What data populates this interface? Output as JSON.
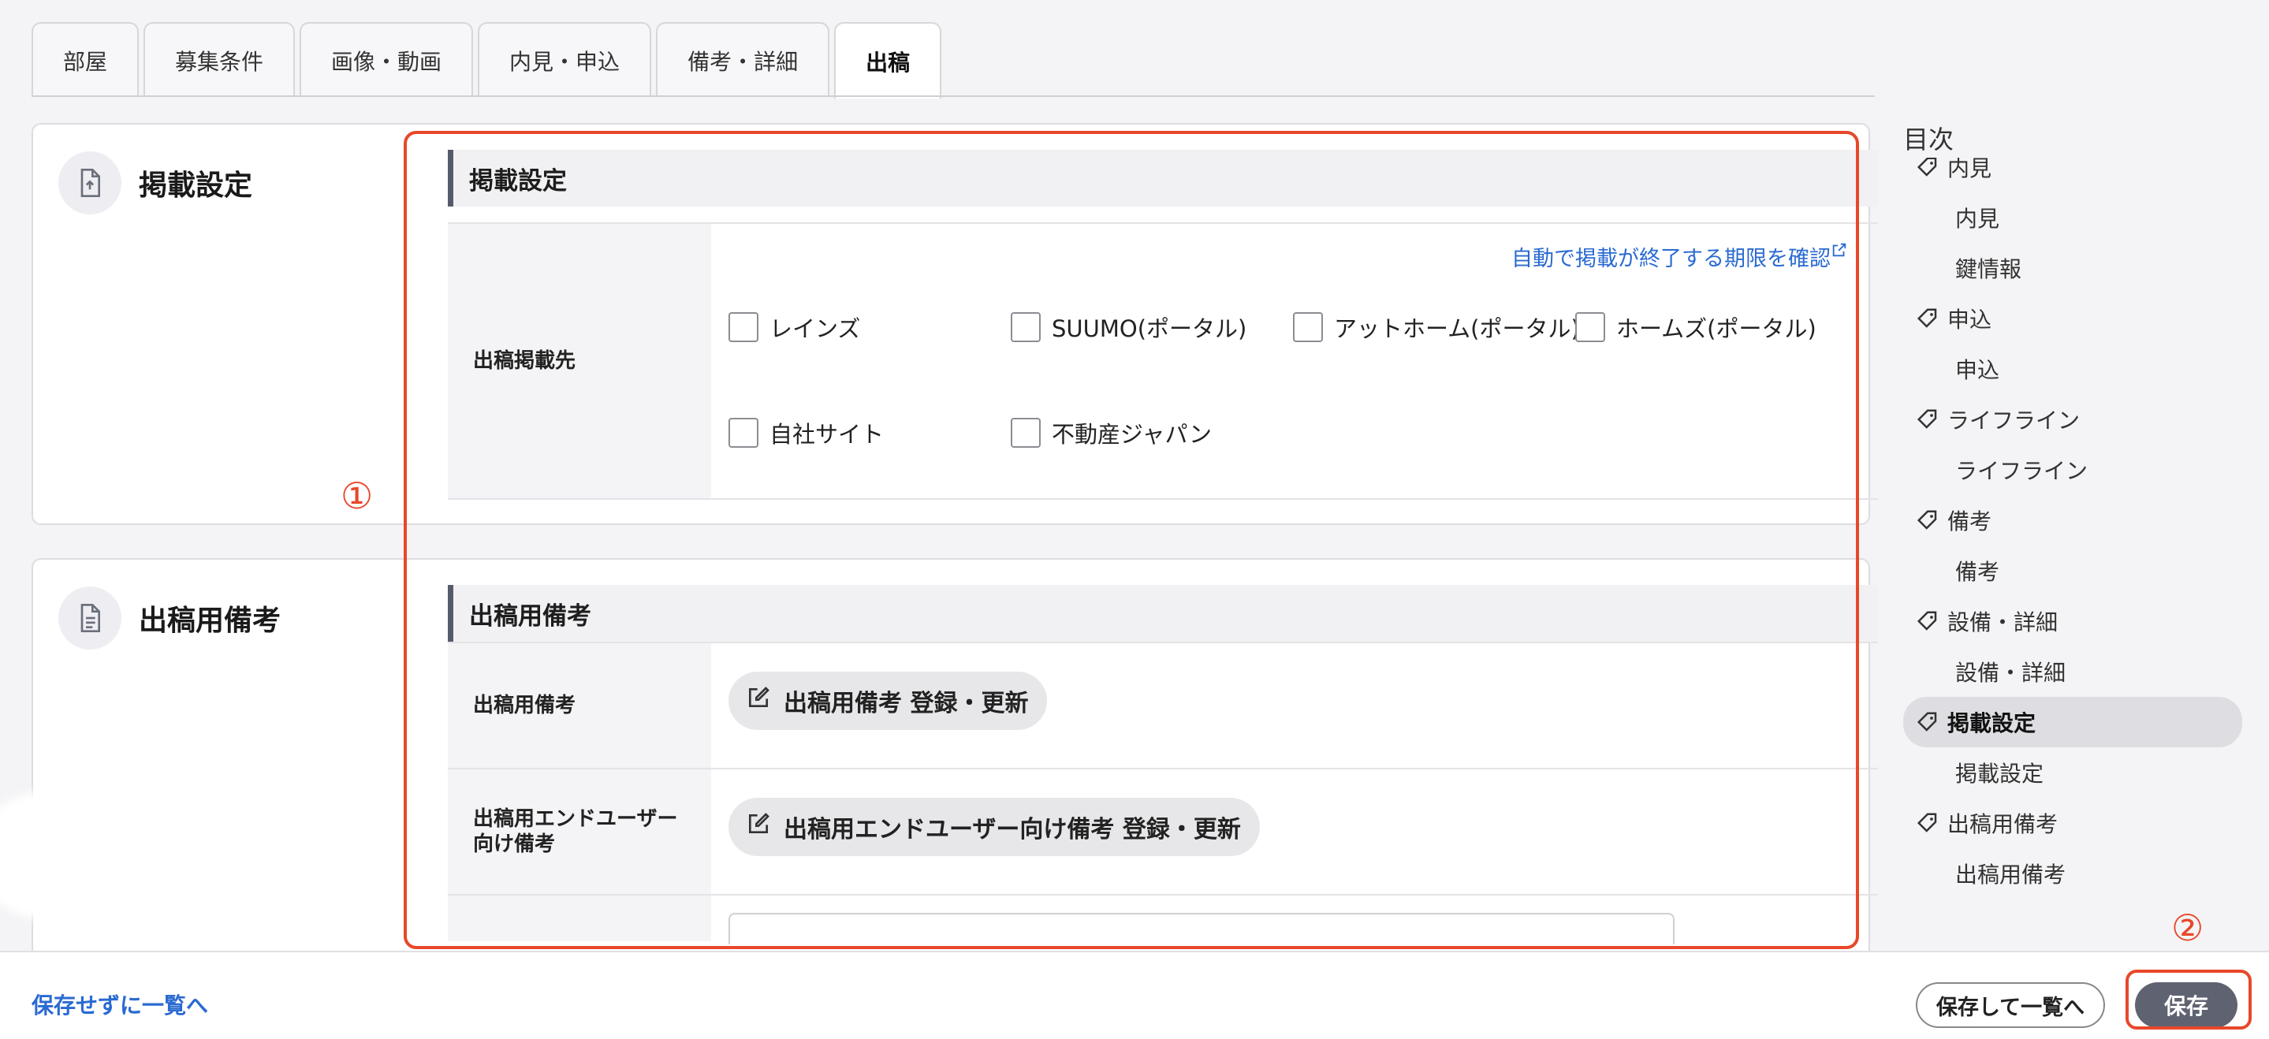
{
  "tabs": [
    "部屋",
    "募集条件",
    "画像・動画",
    "内見・申込",
    "備考・詳細",
    "出稿"
  ],
  "active_tab_index": 5,
  "card1": {
    "title": "掲載設定",
    "annotation": "①",
    "section_title": "掲載設定",
    "row_label": "出稿掲載先",
    "link": "自動で掲載が終了する期限を確認",
    "checkboxes": [
      "レインズ",
      "SUUMO(ポータル)",
      "アットホーム(ポータル)",
      "ホームズ(ポータル)",
      "自社サイト",
      "不動産ジャパン"
    ]
  },
  "card2": {
    "title": "出稿用備考",
    "section_title": "出稿用備考",
    "rows": [
      {
        "label": "出稿用備考",
        "button": "出稿用備考 登録・更新"
      },
      {
        "label": "出稿用エンドユーザー向け備考",
        "button": "出稿用エンドユーザー向け備考 登録・更新"
      }
    ]
  },
  "toc": {
    "title": "目次",
    "items": [
      {
        "label": "内見",
        "type": "parent"
      },
      {
        "label": "内見",
        "type": "child"
      },
      {
        "label": "鍵情報",
        "type": "child"
      },
      {
        "label": "申込",
        "type": "parent"
      },
      {
        "label": "申込",
        "type": "child"
      },
      {
        "label": "ライフライン",
        "type": "parent"
      },
      {
        "label": "ライフライン",
        "type": "child"
      },
      {
        "label": "備考",
        "type": "parent"
      },
      {
        "label": "備考",
        "type": "child"
      },
      {
        "label": "設備・詳細",
        "type": "parent"
      },
      {
        "label": "設備・詳細",
        "type": "child"
      },
      {
        "label": "掲載設定",
        "type": "parent",
        "active": true
      },
      {
        "label": "掲載設定",
        "type": "child"
      },
      {
        "label": "出稿用備考",
        "type": "parent"
      },
      {
        "label": "出稿用備考",
        "type": "child"
      }
    ]
  },
  "footer": {
    "back_link": "保存せずに一覧へ",
    "save_and_list": "保存して一覧へ",
    "save": "保存",
    "annotation": "②"
  },
  "colors": {
    "accent_red": "#e8472a",
    "link_blue": "#2a6ad1",
    "save_button": "#5f6270"
  }
}
